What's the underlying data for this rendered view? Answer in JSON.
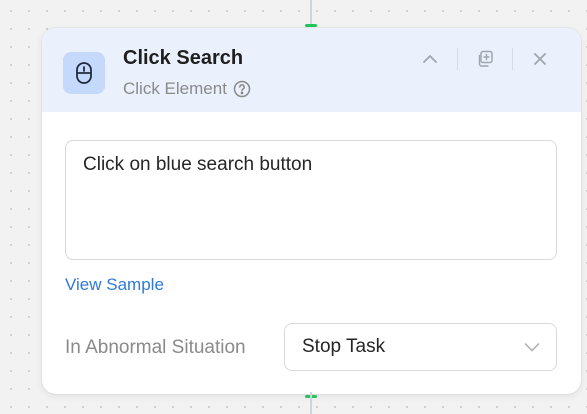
{
  "step": {
    "title": "Click Search",
    "subtitle": "Click Element",
    "icon": "mouse-icon"
  },
  "instruction": {
    "value": "Click on blue search button"
  },
  "view_sample_label": "View Sample",
  "abnormal": {
    "label": "In Abnormal Situation",
    "selected": "Stop Task"
  },
  "colors": {
    "header_bg": "#eaf1fd",
    "icon_bg": "#c4d9fb",
    "link": "#2f7ad8",
    "connector": "#22c55e"
  }
}
